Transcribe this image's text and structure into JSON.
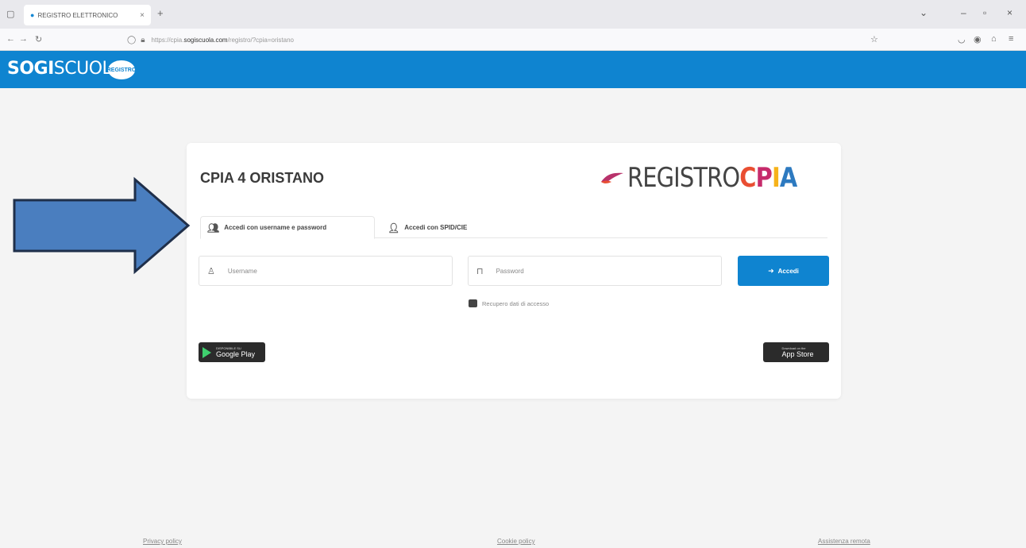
{
  "browser": {
    "tab_title": "REGISTRO ELETTRONICO",
    "tab_close": "×",
    "new_tab": "+",
    "url_domain": "sogiscuola.com",
    "url_prefix": "https://cpia.",
    "url_suffix": "/registro/?cpia=oristano"
  },
  "header": {
    "brand_bold": "SOGI",
    "brand_light": "SCUOLA",
    "logo_text": "REGISTRO",
    "color": "#0f84d0"
  },
  "login": {
    "school_name": "CPIA 4 ORISTANO",
    "logo_prefix": "REGISTRO",
    "logo_c": "C",
    "logo_p": "P",
    "logo_i": "I",
    "logo_a": "A",
    "tab_userpass": "Accedi con username e password",
    "tab_spid": "Accedi con SPID/CIE",
    "username_placeholder": "Username",
    "password_placeholder": "Password",
    "login_button": "Accedi",
    "recover_link": "Recupero dati di accesso",
    "google_small": "DISPONIBILE SU",
    "google_big": "Google Play",
    "apple_small": "Download on the",
    "apple_big": "App Store"
  },
  "footer": {
    "privacy": "Privacy policy",
    "cookie": "Cookie policy",
    "assistance": "Assistenza remota"
  },
  "icons": {
    "user": "user-icon",
    "lock": "lock-icon",
    "signin": "sign-in-icon",
    "id_card": "id-card-icon"
  },
  "colors": {
    "accent": "#0f84d0",
    "arrow_fill": "#4a7ebf",
    "arrow_stroke": "#1f2f4a"
  }
}
